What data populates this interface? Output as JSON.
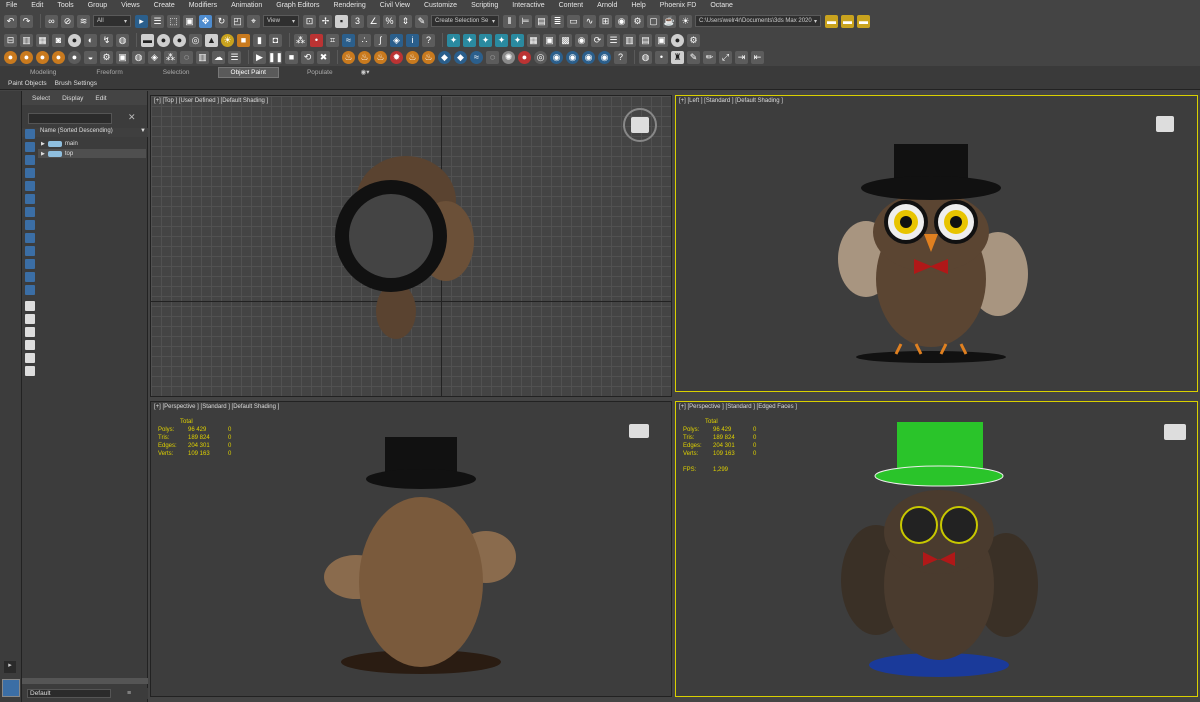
{
  "menu": [
    "File",
    "Edit",
    "Tools",
    "Group",
    "Views",
    "Create",
    "Modifiers",
    "Animation",
    "Graph Editors",
    "Rendering",
    "Civil View",
    "Customize",
    "Scripting",
    "Interactive",
    "Content",
    "Arnold",
    "Help",
    "Phoenix FD",
    "Octane"
  ],
  "toolbar": {
    "filter_value": "All",
    "ref_coord_value": "View",
    "named_selection_placeholder": "Create Selection Se",
    "project_path": "C:\\Users\\welr4r\\Documents\\3ds Max 2020"
  },
  "ribbon": {
    "tabs": [
      "Modeling",
      "Freeform",
      "Selection",
      "Object Paint",
      "Populate"
    ],
    "active": "Object Paint"
  },
  "subribbon": [
    "Paint Objects",
    "Brush Settings"
  ],
  "explorer": {
    "tabs": [
      "Select",
      "Display",
      "Edit"
    ],
    "column_header": "Name (Sorted Descending)",
    "rows": [
      {
        "name": "main"
      },
      {
        "name": "top"
      }
    ]
  },
  "layer": {
    "value": "Default"
  },
  "viewports": {
    "top": {
      "label": "[+] [Top ] [User Defined ] [Default Shading ]"
    },
    "left": {
      "label": "[+] [Left ] [Standard ] [Default Shading ]"
    },
    "persp": {
      "label": "[+] [Perspective ] [Standard ] [Default Shading ]",
      "stats": {
        "header": "Total",
        "rows": [
          {
            "k": "Polys:",
            "v": "96 429",
            "s": "0"
          },
          {
            "k": "Tris:",
            "v": "189 824",
            "s": "0"
          },
          {
            "k": "Edges:",
            "v": "204 301",
            "s": "0"
          },
          {
            "k": "Verts:",
            "v": "109 163",
            "s": "0"
          }
        ]
      }
    },
    "edge": {
      "label": "[+] [Perspective ] [Standard ] [Edged Faces ]",
      "stats": {
        "header": "Total",
        "rows": [
          {
            "k": "Polys:",
            "v": "96 429",
            "s": "0"
          },
          {
            "k": "Tris:",
            "v": "189 824",
            "s": "0"
          },
          {
            "k": "Edges:",
            "v": "204 301",
            "s": "0"
          },
          {
            "k": "Verts:",
            "v": "109 163",
            "s": "0"
          }
        ],
        "fps_label": "FPS:",
        "fps": "1,299"
      }
    }
  }
}
